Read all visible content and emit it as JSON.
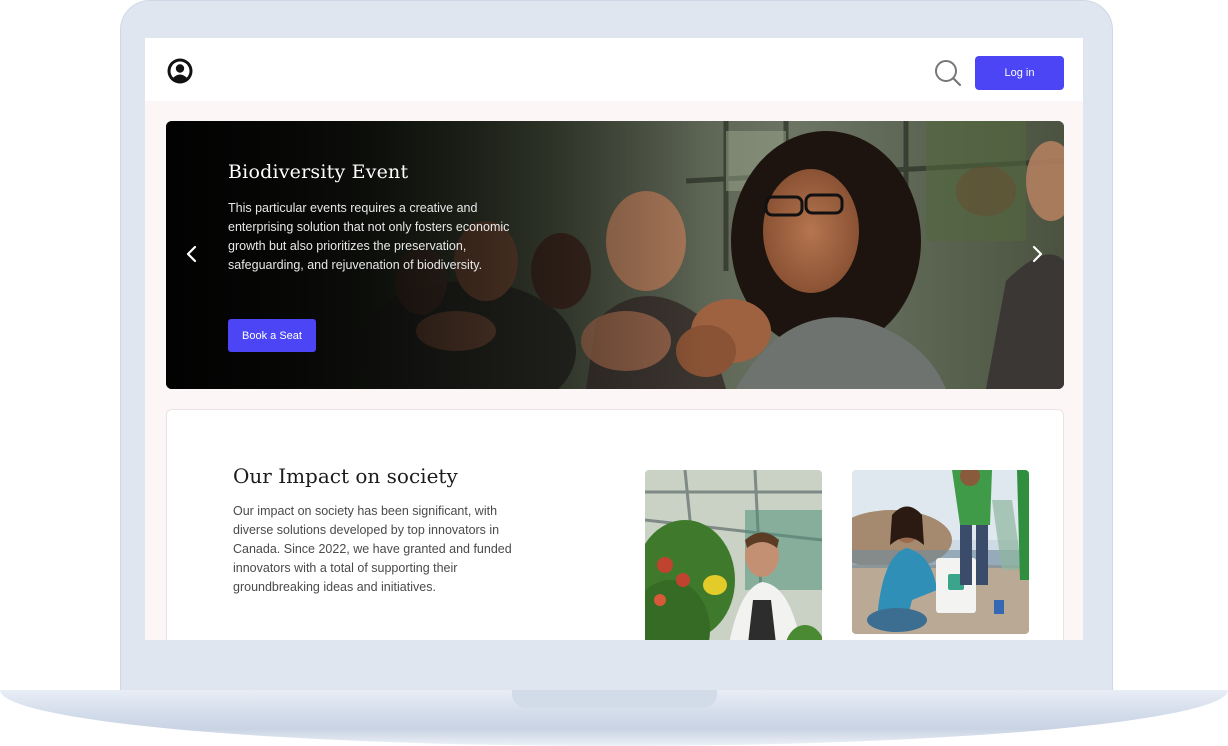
{
  "header": {
    "logo_icon": "user-circle-logo-icon",
    "search_icon": "search-icon",
    "login_label": "Log in",
    "accent_color": "#4b45f5"
  },
  "hero": {
    "title": "Biodiversity Event",
    "description": "This particular events requires a creative and enterprising solution that not only fosters economic growth but also prioritizes the preservation, safeguarding, and rejuvenation of biodiversity.",
    "cta_label": "Book a Seat",
    "prev_icon": "chevron-left-icon",
    "next_icon": "chevron-right-icon"
  },
  "impact": {
    "title": "Our Impact on society",
    "description": "Our impact on society has been significant, with diverse solutions developed by top innovators in Canada. Since 2022, we have granted and funded innovators with a total of supporting their groundbreaking ideas and initiatives.",
    "images": [
      "greenhouse-gardener-image",
      "beach-cleanup-volunteers-image"
    ]
  }
}
